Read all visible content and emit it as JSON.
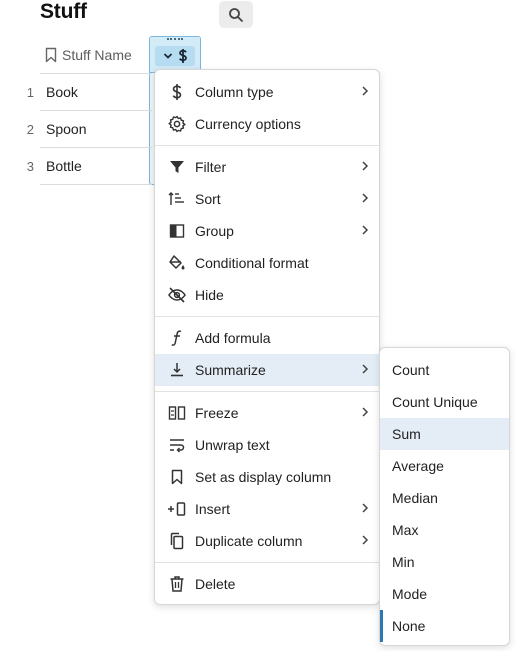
{
  "page": {
    "title": "Stuff"
  },
  "table": {
    "column_header": "Stuff Name",
    "rows": [
      {
        "num": "1",
        "value": "Book"
      },
      {
        "num": "2",
        "value": "Spoon"
      },
      {
        "num": "3",
        "value": "Bottle"
      }
    ]
  },
  "column_menu": {
    "items": [
      {
        "label": "Column type",
        "icon": "dollar-icon",
        "has_submenu": true
      },
      {
        "label": "Currency options",
        "icon": "gear-icon",
        "has_submenu": false
      },
      {
        "label": "Filter",
        "icon": "filter-icon",
        "has_submenu": true
      },
      {
        "label": "Sort",
        "icon": "sort-icon",
        "has_submenu": true
      },
      {
        "label": "Group",
        "icon": "group-icon",
        "has_submenu": true
      },
      {
        "label": "Conditional format",
        "icon": "paint-bucket-icon",
        "has_submenu": false
      },
      {
        "label": "Hide",
        "icon": "eye-off-icon",
        "has_submenu": false
      },
      {
        "label": "Add formula",
        "icon": "formula-icon",
        "has_submenu": false
      },
      {
        "label": "Summarize",
        "icon": "summarize-icon",
        "has_submenu": true,
        "highlighted": true
      },
      {
        "label": "Freeze",
        "icon": "freeze-icon",
        "has_submenu": true
      },
      {
        "label": "Unwrap text",
        "icon": "wrap-text-icon",
        "has_submenu": false
      },
      {
        "label": "Set as display column",
        "icon": "bookmark-icon",
        "has_submenu": false
      },
      {
        "label": "Insert",
        "icon": "insert-column-icon",
        "has_submenu": true
      },
      {
        "label": "Duplicate column",
        "icon": "duplicate-icon",
        "has_submenu": true
      },
      {
        "label": "Delete",
        "icon": "trash-icon",
        "has_submenu": false
      }
    ]
  },
  "summarize_menu": {
    "items": [
      {
        "label": "Count"
      },
      {
        "label": "Count Unique"
      },
      {
        "label": "Sum",
        "hovered": true
      },
      {
        "label": "Average"
      },
      {
        "label": "Median"
      },
      {
        "label": "Max"
      },
      {
        "label": "Min"
      },
      {
        "label": "Mode"
      },
      {
        "label": "None",
        "selected": true
      }
    ]
  },
  "colors": {
    "accent": "#2b78b6",
    "highlight": "#e4edf6",
    "selected_column": "#d3eaf7"
  }
}
